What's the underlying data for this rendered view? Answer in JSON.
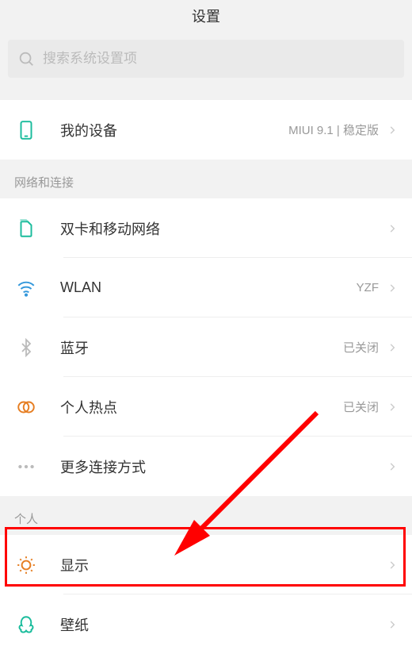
{
  "header": {
    "title": "设置"
  },
  "search": {
    "placeholder": "搜索系统设置项"
  },
  "device": {
    "label": "我的设备",
    "value": "MIUI 9.1 | 稳定版"
  },
  "sections": {
    "network": {
      "title": "网络和连接",
      "items": {
        "sim": {
          "label": "双卡和移动网络",
          "value": ""
        },
        "wlan": {
          "label": "WLAN",
          "value": "YZF"
        },
        "bluetooth": {
          "label": "蓝牙",
          "value": "已关闭"
        },
        "hotspot": {
          "label": "个人热点",
          "value": "已关闭"
        },
        "more": {
          "label": "更多连接方式",
          "value": ""
        }
      }
    },
    "personal": {
      "title": "个人",
      "items": {
        "display": {
          "label": "显示",
          "value": ""
        },
        "wallpaper": {
          "label": "壁纸",
          "value": ""
        }
      }
    }
  },
  "colors": {
    "iconGreen": "#1abc9c",
    "iconBlue": "#3498db",
    "iconOrange": "#e67e22",
    "iconGray": "#bbbbbb"
  }
}
